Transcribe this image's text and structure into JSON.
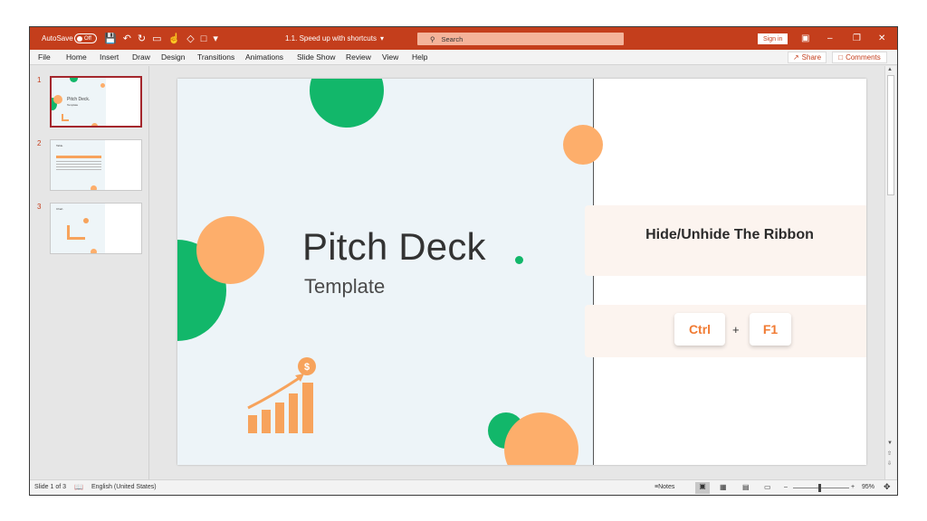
{
  "titlebar": {
    "autosave_label": "AutoSave",
    "autosave_state": "Off",
    "document_title": "1.1. Speed up with shortcuts",
    "search_placeholder": "Search",
    "signin_label": "Sign in",
    "accent_color": "#c43e1c"
  },
  "menu": {
    "items": [
      "File",
      "Home",
      "Insert",
      "Draw",
      "Design",
      "Transitions",
      "Animations",
      "Slide Show",
      "Review",
      "View",
      "Help"
    ],
    "share_label": "Share",
    "comments_label": "Comments"
  },
  "thumbnails": [
    {
      "number": "1",
      "title": "Pitch Deck.",
      "subtitle": "Template",
      "selected": true
    },
    {
      "number": "2",
      "title": "Table.",
      "selected": false
    },
    {
      "number": "3",
      "title": "Chart.",
      "selected": false
    }
  ],
  "slide": {
    "title": "Pitch Deck",
    "subtitle": "Template",
    "coin_symbol": "$",
    "card_title": "Hide/Unhide The Ribbon",
    "key1": "Ctrl",
    "plus": "+",
    "key2": "F1",
    "colors": {
      "green": "#12b76a",
      "orange": "#fdae6b",
      "chart_orange": "#f7a35c",
      "key_text": "#f17b33"
    }
  },
  "status": {
    "slide_info": "Slide 1 of 3",
    "language": "English (United States)",
    "notes_label": "Notes",
    "zoom_level": "95%"
  }
}
